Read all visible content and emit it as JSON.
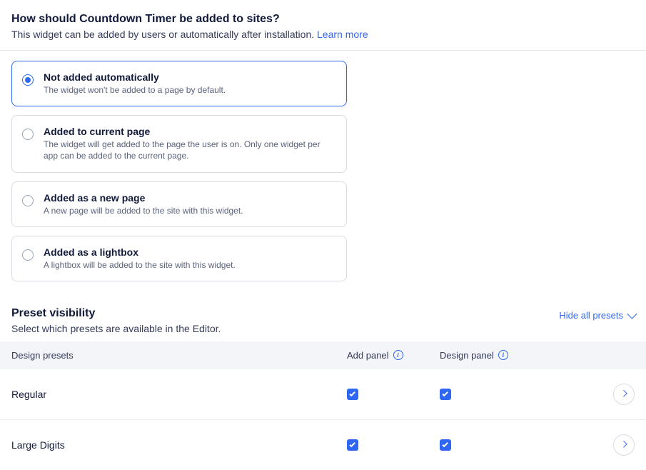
{
  "installation": {
    "title": "How should Countdown Timer be added to sites?",
    "desc": "This widget can be added by users or automatically after installation. ",
    "learn_more": "Learn more",
    "options": [
      {
        "id": "not-auto",
        "title": "Not added automatically",
        "desc": "The widget won't be added to a page by default.",
        "selected": true
      },
      {
        "id": "current-page",
        "title": "Added to current page",
        "desc": "The widget will get added to the page the user is on. Only one widget per app can be added to the current page.",
        "selected": false
      },
      {
        "id": "new-page",
        "title": "Added as a new page",
        "desc": "A new page will be added to the site with this widget.",
        "selected": false
      },
      {
        "id": "lightbox",
        "title": "Added as a lightbox",
        "desc": "A lightbox will be added to the site with this widget.",
        "selected": false
      }
    ]
  },
  "presets": {
    "title": "Preset visibility",
    "desc": "Select which presets are available in the Editor.",
    "hide_all": "Hide all presets",
    "columns": {
      "name": "Design presets",
      "add_panel": "Add panel",
      "design_panel": "Design panel"
    },
    "rows": [
      {
        "name": "Regular",
        "add_panel": true,
        "design_panel": true
      },
      {
        "name": "Large Digits",
        "add_panel": true,
        "design_panel": true
      }
    ]
  }
}
